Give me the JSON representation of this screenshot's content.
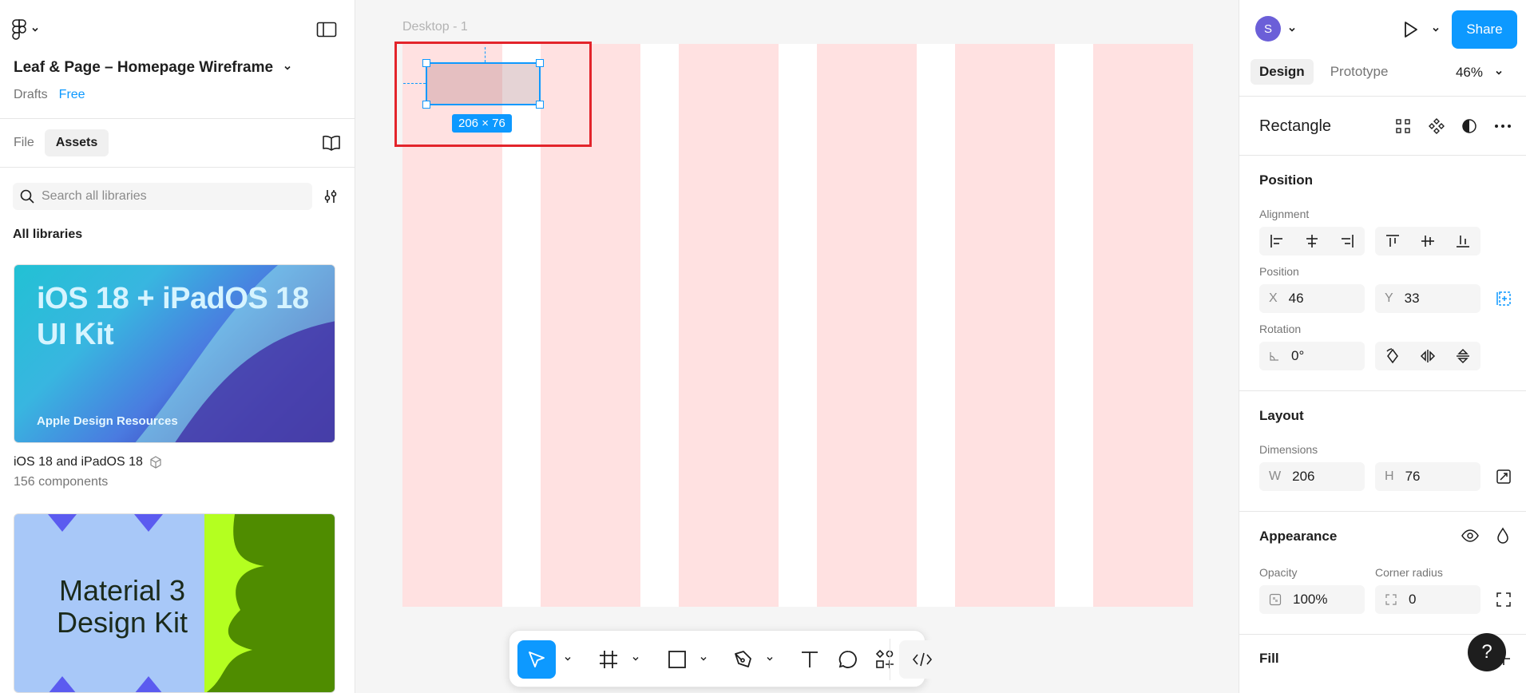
{
  "left_panel": {
    "file_title": "Leaf & Page – Homepage Wireframe",
    "location": "Drafts",
    "plan": "Free",
    "tabs": [
      {
        "label": "File"
      },
      {
        "label": "Assets"
      }
    ],
    "search": {
      "placeholder": "Search all libraries",
      "value": ""
    },
    "section_title": "All libraries",
    "libraries": [
      {
        "thumb_title": "iOS 18 + iPadOS 18 UI Kit",
        "thumb_line1": "iOS 18 + iPadOS 18",
        "thumb_line2": "UI Kit",
        "thumb_brand": " Apple Design Resources",
        "name": "iOS 18 and iPadOS 18",
        "count": "156 components"
      },
      {
        "thumb_line1": "Material 3",
        "thumb_line2": "Design Kit"
      }
    ]
  },
  "canvas": {
    "frame_label": "Desktop - 1",
    "selection_size": "206 × 76"
  },
  "right_panel": {
    "avatar_initial": "S",
    "share_label": "Share",
    "tabs": [
      {
        "label": "Design"
      },
      {
        "label": "Prototype"
      }
    ],
    "zoom": "46%",
    "layer_type": "Rectangle",
    "position": {
      "title": "Position",
      "alignment_label": "Alignment",
      "position_label": "Position",
      "x_prefix": "X",
      "x": "46",
      "y_prefix": "Y",
      "y": "33",
      "rotation_label": "Rotation",
      "rotation": "0°"
    },
    "layout": {
      "title": "Layout",
      "dimensions_label": "Dimensions",
      "w_prefix": "W",
      "w": "206",
      "h_prefix": "H",
      "h": "76"
    },
    "appearance": {
      "title": "Appearance",
      "opacity_label": "Opacity",
      "opacity": "100%",
      "radius_label": "Corner radius",
      "radius": "0"
    },
    "fill": {
      "title": "Fill"
    },
    "help": "?"
  },
  "colors": {
    "accent": "#0d99ff",
    "grid_column": "#ffe1e1",
    "annotation": "#e3242b"
  }
}
